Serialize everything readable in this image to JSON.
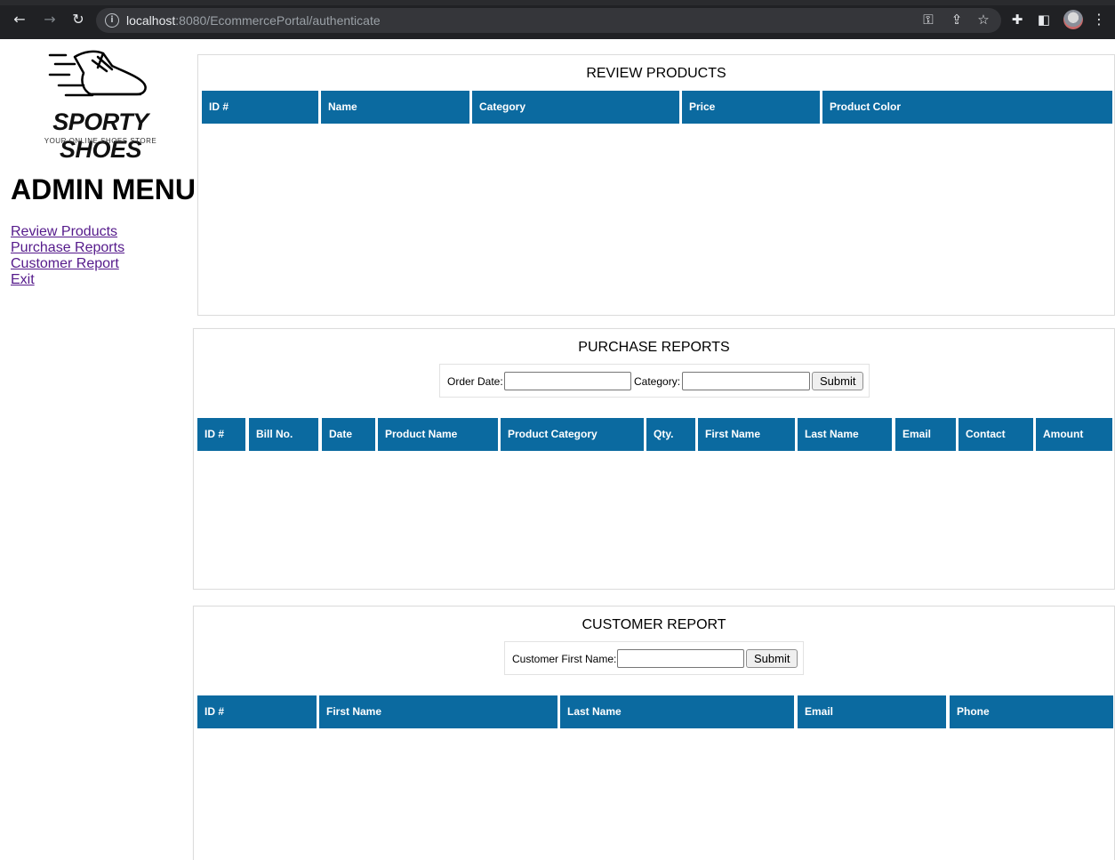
{
  "browser": {
    "url_host": "localhost",
    "url_rest": ":8080/EcommercePortal/authenticate",
    "info_icon": "info-icon",
    "icons": [
      "back-icon",
      "forward-icon",
      "reload-icon",
      "key-icon",
      "share-icon",
      "star-icon",
      "extensions-icon",
      "sidepanel-icon",
      "profile-avatar",
      "menu-icon"
    ]
  },
  "brand": {
    "name": "SPORTY SHOES",
    "tagline": "YOUR ONLINE SHOES STORE",
    "logo_icon": "running-shoe-icon"
  },
  "sidebar": {
    "title": "ADMIN MENU",
    "links": [
      {
        "label": "Review Products"
      },
      {
        "label": "Purchase Reports"
      },
      {
        "label": "Customer Report"
      },
      {
        "label": "Exit"
      }
    ],
    "link_color": "#551a8b"
  },
  "review_products": {
    "title": "REVIEW PRODUCTS",
    "columns": [
      "ID #",
      "Name",
      "Category",
      "Price",
      "Product Color"
    ]
  },
  "purchase_reports": {
    "title": "PURCHASE REPORTS",
    "form": {
      "order_date_label": "Order Date:",
      "order_date_value": "",
      "category_label": "Category:",
      "category_value": "",
      "submit_label": "Submit"
    },
    "columns": [
      "ID #",
      "Bill No.",
      "Date",
      "Product Name",
      "Product Category",
      "Qty.",
      "First Name",
      "Last Name",
      "Email",
      "Contact",
      "Amount"
    ]
  },
  "customer_report": {
    "title": "CUSTOMER REPORT",
    "form": {
      "first_name_label": "Customer First Name:",
      "first_name_value": "",
      "submit_label": "Submit"
    },
    "columns": [
      "ID #",
      "First Name",
      "Last Name",
      "Email",
      "Phone"
    ]
  },
  "colors": {
    "table_header_bg": "#0b6aa0",
    "table_header_text": "#ffffff",
    "browser_bg": "#202124"
  }
}
